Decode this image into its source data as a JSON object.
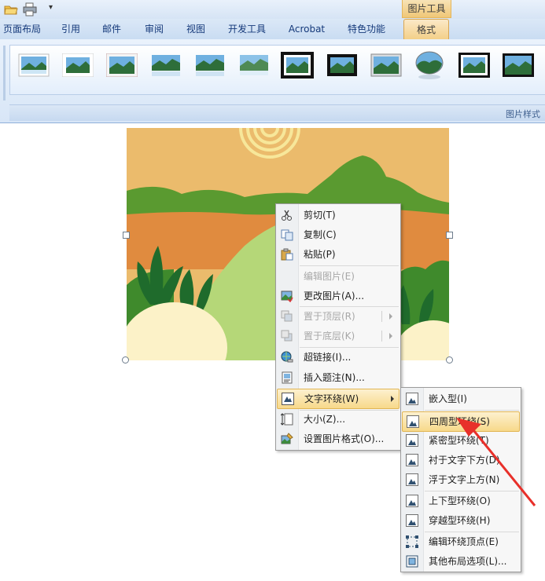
{
  "quick_access": {
    "open_icon": "folder-open-icon",
    "print_icon": "print-icon",
    "customize": "▾"
  },
  "contextual_tab_title": "图片工具",
  "tabs": [
    {
      "label": "页面布局",
      "active": false
    },
    {
      "label": "引用",
      "active": false
    },
    {
      "label": "邮件",
      "active": false
    },
    {
      "label": "审阅",
      "active": false
    },
    {
      "label": "视图",
      "active": false
    },
    {
      "label": "开发工具",
      "active": false
    },
    {
      "label": "Acrobat",
      "active": false
    },
    {
      "label": "特色功能",
      "active": false
    },
    {
      "label": "格式",
      "active": true
    }
  ],
  "ribbon": {
    "group_label": "图片样式"
  },
  "context_menu": {
    "items": [
      {
        "label": "剪切(T)",
        "icon": "scissors-icon",
        "disabled": false
      },
      {
        "label": "复制(C)",
        "icon": "copy-icon",
        "disabled": false
      },
      {
        "label": "粘贴(P)",
        "icon": "paste-icon",
        "disabled": false
      },
      {
        "label": "编辑图片(E)",
        "icon": "",
        "disabled": true
      },
      {
        "label": "更改图片(A)...",
        "icon": "change-picture-icon",
        "disabled": false
      },
      {
        "label": "置于顶层(R)",
        "icon": "bring-front-icon",
        "disabled": true
      },
      {
        "label": "置于底层(K)",
        "icon": "send-back-icon",
        "disabled": true
      },
      {
        "label": "超链接(I)...",
        "icon": "hyperlink-icon",
        "disabled": false
      },
      {
        "label": "插入题注(N)...",
        "icon": "caption-icon",
        "disabled": false
      },
      {
        "label": "文字环绕(W)",
        "icon": "text-wrap-icon",
        "disabled": false
      },
      {
        "label": "大小(Z)...",
        "icon": "size-icon",
        "disabled": false
      },
      {
        "label": "设置图片格式(O)...",
        "icon": "format-picture-icon",
        "disabled": false
      }
    ]
  },
  "submenu": {
    "items": [
      {
        "label": "嵌入型(I)"
      },
      {
        "label": "四周型环绕(S)"
      },
      {
        "label": "紧密型环绕(T)"
      },
      {
        "label": "衬于文字下方(D)"
      },
      {
        "label": "浮于文字上方(N)"
      },
      {
        "label": "上下型环绕(O)"
      },
      {
        "label": "穿越型环绕(H)"
      },
      {
        "label": "编辑环绕顶点(E)"
      },
      {
        "label": "其他布局选项(L)..."
      }
    ]
  },
  "colors": {
    "accent": "#f0c777",
    "arrow": "#e8302a",
    "highlight": "#f7d98a"
  }
}
